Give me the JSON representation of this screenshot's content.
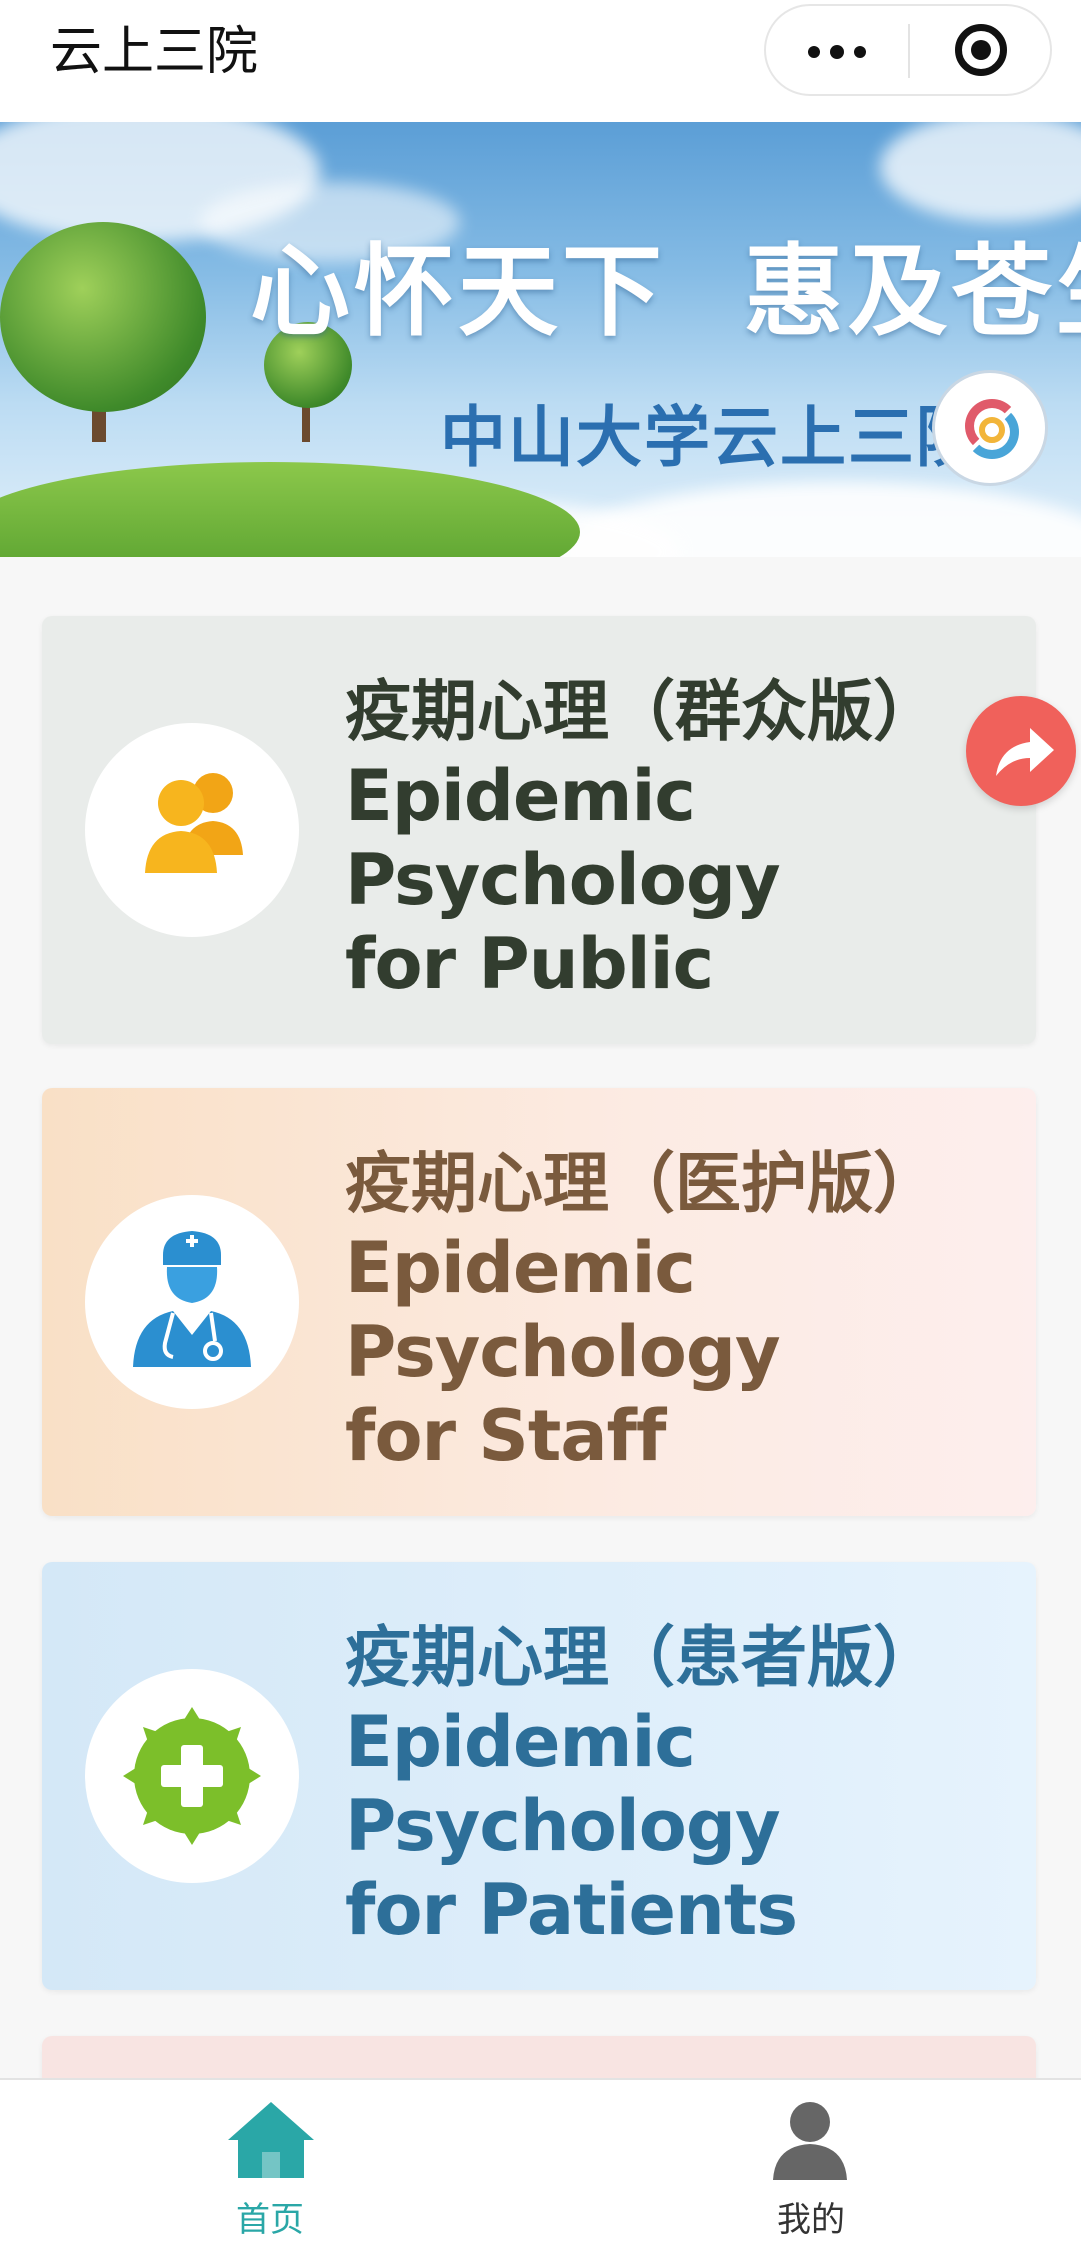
{
  "header": {
    "app_title": "云上三院",
    "more_icon": "ellipsis-icon",
    "close_icon": "target-circle-icon"
  },
  "banner": {
    "slogan": "心怀天下  惠及苍生",
    "subtitle": "中山大学云上三院",
    "logo_icon": "hospital-seal-icon"
  },
  "cards": [
    {
      "title": "疫期心理（群众版）",
      "en_lines": [
        "Epidemic",
        "Psychology",
        "for Public"
      ],
      "icon": "people-icon",
      "color": "#323d2f",
      "bg": "#e9ecea"
    },
    {
      "title": "疫期心理（医护版）",
      "en_lines": [
        "Epidemic",
        "Psychology",
        "for Staff"
      ],
      "icon": "doctor-icon",
      "color": "#7a5a3d",
      "bg": "#fbe6d4"
    },
    {
      "title": "疫期心理（患者版）",
      "en_lines": [
        "Epidemic",
        "Psychology",
        "for Patients"
      ],
      "icon": "medical-cross-badge-icon",
      "color": "#2d6f99",
      "bg": "#dcedf9"
    }
  ],
  "share_button": {
    "icon": "share-arrow-icon",
    "color": "#f0615b"
  },
  "tabbar": {
    "items": [
      {
        "label": "首页",
        "icon": "home-icon",
        "active": true,
        "color": "#2aa7a7"
      },
      {
        "label": "我的",
        "icon": "user-icon",
        "active": false,
        "color": "#333333"
      }
    ]
  }
}
